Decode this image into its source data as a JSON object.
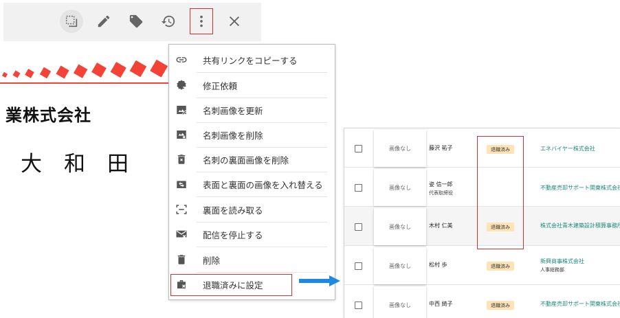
{
  "toolbar": {
    "icons": [
      "select-icon",
      "pencil-icon",
      "tag-icon",
      "history-icon",
      "more-vert-icon",
      "close-icon"
    ]
  },
  "card": {
    "company": "業株式会社",
    "person": "大和田 昭"
  },
  "menu": {
    "items": [
      {
        "icon": "link-icon",
        "label": "共有リンクをコピーする"
      },
      {
        "icon": "edit-request-icon",
        "label": "修正依頼"
      },
      {
        "icon": "image-update-icon",
        "label": "名刺画像を更新"
      },
      {
        "icon": "image-delete-icon",
        "label": "名刺画像を削除"
      },
      {
        "icon": "trash-icon",
        "label": "名刺の裏面画像を削除"
      },
      {
        "icon": "swap-icon",
        "label": "表面と裏面の画像を入れ替える"
      },
      {
        "icon": "scan-icon",
        "label": "裏面を読み取る"
      },
      {
        "icon": "mail-off-icon",
        "label": "配信を停止する"
      },
      {
        "icon": "trash-icon",
        "label": "削除"
      },
      {
        "icon": "retire-icon",
        "label": "退職済みに設定"
      }
    ]
  },
  "list": {
    "rows": [
      {
        "image": "画像なし",
        "name": "藤沢 祐子",
        "title": "",
        "badge": "退職済み",
        "company": "エネバイヤー株式会社",
        "dept": ""
      },
      {
        "image": "画像なし",
        "name": "姿 信一郎",
        "title": "代表取締役",
        "badge": "",
        "company": "不動産売却サポート関東株式会社",
        "dept": ""
      },
      {
        "image": "画像なし",
        "name": "木村 仁美",
        "title": "",
        "badge": "退職済み",
        "company": "株式会社青木建築設計積算事務所",
        "dept": ""
      },
      {
        "image": "画像なし",
        "name": "松村 歩",
        "title": "",
        "badge": "退職済み",
        "company": "新興商事株式会社",
        "dept": "人事総務部"
      },
      {
        "image": "画像なし",
        "name": "中西 綺子",
        "title": "",
        "badge": "退職済み",
        "company": "不動産売却サポート関東株式会社",
        "dept": ""
      }
    ]
  },
  "colors": {
    "highlight": "#d32f2f",
    "arrow": "#1e88e5",
    "badge": "#fde3b5",
    "company_link": "#1a8a7a",
    "card_stamp": "#f44336"
  }
}
